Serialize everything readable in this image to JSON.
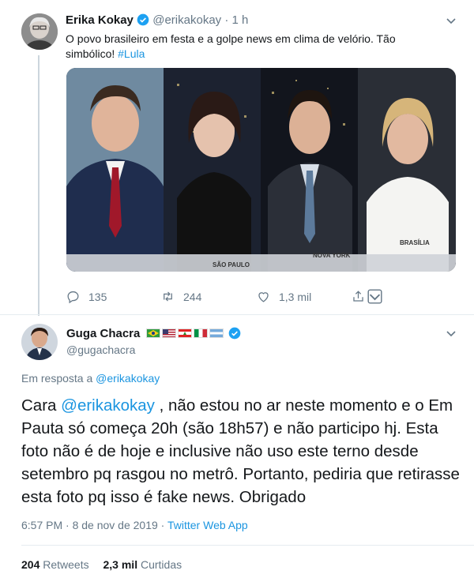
{
  "tweet1": {
    "author_name": "Erika Kokay",
    "handle": "@erikakokay",
    "separator": "·",
    "time": "1 h",
    "text_main": "O povo brasileiro em festa e a golpe news em clima de velório. Tão simbólico!",
    "hashtag": "#Lula",
    "photo_labels": [
      "SÃO PAULO",
      "NOVA YORK",
      "BRASÍLIA"
    ],
    "replies": "135",
    "retweets": "244",
    "likes": "1,3 mil"
  },
  "tweet2": {
    "author_name": "Guga Chacra",
    "handle": "@gugachacra",
    "reply_prefix": "Em resposta a",
    "reply_to": "@erikakokay",
    "text_pre": "Cara",
    "text_mention": "@erikakokay",
    "text_post": ", não estou no ar neste momento e o Em Pauta só começa 20h (são 18h57) e não participo hj. Esta foto não é de hoje e inclusive não uso este terno desde setembro pq rasgou no metrô. Portanto, pediria que retirasse esta foto pq isso é fake news. Obrigado",
    "timestamp": "6:57 PM · 8 de nov de 2019 ·",
    "source": "Twitter Web App",
    "retweets_count": "204",
    "retweets_label": "Retweets",
    "likes_count": "2,3 mil",
    "likes_label": "Curtidas"
  },
  "colors": {
    "accent": "#1b95e0",
    "verified": "#1da1f2",
    "muted": "#657786",
    "divider": "#e6ecf0"
  },
  "icons": [
    "reply-icon",
    "retweet-icon",
    "like-icon",
    "share-icon",
    "chevron-down-icon",
    "verified-icon"
  ]
}
